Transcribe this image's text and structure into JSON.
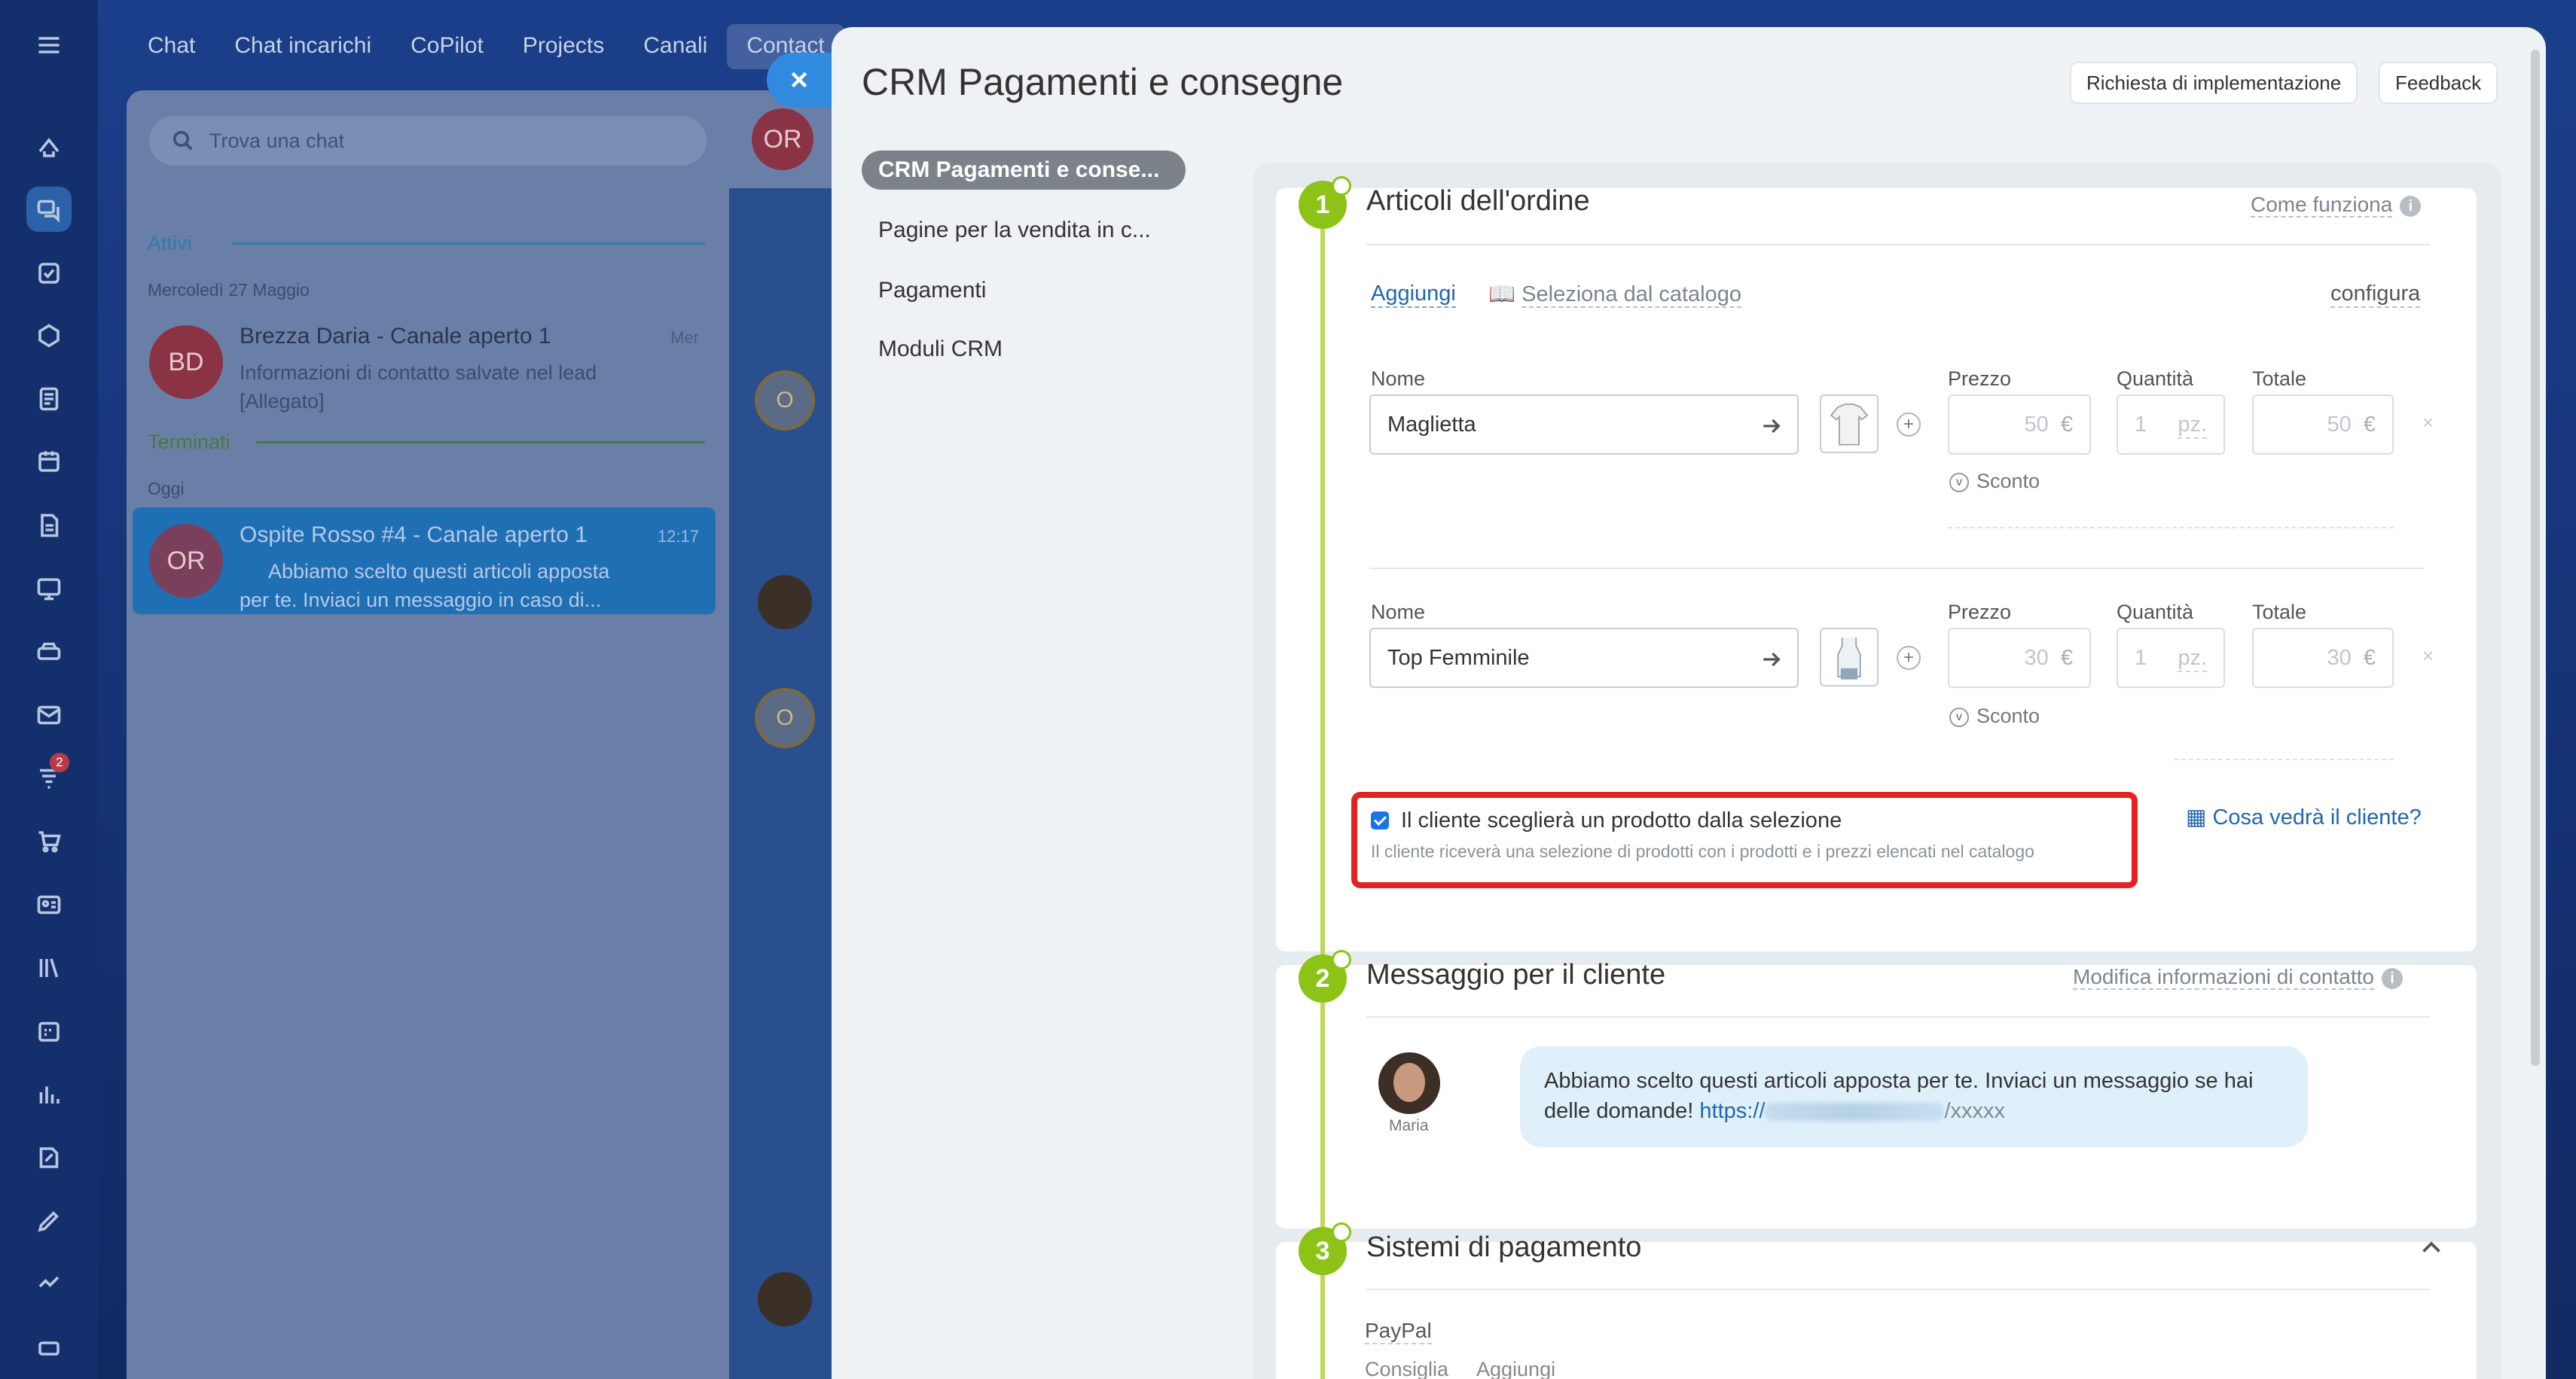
{
  "nav": {
    "tabs": [
      "Chat",
      "Chat incarichi",
      "CoPilot",
      "Projects",
      "Canali",
      "Contact"
    ],
    "selected_index": 5
  },
  "rail": {
    "badge_count": "2"
  },
  "chat": {
    "search_placeholder": "Trova una chat",
    "section_active": "Attivi",
    "date_1": "Mercoledì 27 Maggio",
    "item_1": {
      "avatar": "BD",
      "name": "Brezza Daria - Canale aperto 1",
      "time": "Mer",
      "message": "Informazioni di contatto salvate nel lead [Allegato]"
    },
    "section_closed": "Terminati",
    "date_2": "Oggi",
    "item_2": {
      "avatar": "OR",
      "name": "Ospite Rosso #4 - Canale aperto 1",
      "time": "12:17",
      "message": "Abbiamo scelto questi articoli apposta per te. Inviaci un messaggio in caso di..."
    },
    "conv_avatar": "OR",
    "conv_small_avatar": "O"
  },
  "slider": {
    "title": "CRM Pagamenti e consegne",
    "btn_impl": "Richiesta di implementazione",
    "btn_feedback": "Feedback",
    "menu": [
      "CRM Pagamenti e conse...",
      "Pagine per la vendita in c...",
      "Pagamenti",
      "Moduli CRM"
    ]
  },
  "order": {
    "step": "1",
    "title": "Articoli dell'ordine",
    "how_it_works": "Come funziona",
    "add": "Aggiungi",
    "select_catalog": "Seleziona dal catalogo",
    "configure": "configura",
    "label_name": "Nome",
    "label_price": "Prezzo",
    "label_qty": "Quantità",
    "label_total": "Totale",
    "discount": "Sconto",
    "products": [
      {
        "name": "Maglietta",
        "price": "50",
        "currency": "€",
        "qty": "1",
        "unit": "pz.",
        "total": "50"
      },
      {
        "name": "Top Femminile",
        "price": "30",
        "currency": "€",
        "qty": "1",
        "unit": "pz.",
        "total": "30"
      }
    ],
    "checkbox_label": "Il cliente sceglierà un prodotto dalla selezione",
    "checkbox_checked": true,
    "checkbox_hint": "Il cliente riceverà una selezione di prodotti con i prodotti e i prezzi elencati nel catalogo",
    "preview_link": "Cosa vedrà il cliente?"
  },
  "message": {
    "step": "2",
    "title": "Messaggio per il cliente",
    "edit_contact": "Modifica informazioni di contatto",
    "sender": "Maria",
    "text": "Abbiamo scelto questi articoli apposta per te. Inviaci un messaggio se hai delle domande!",
    "link_prefix": "https://",
    "link_suffix": "/xxxxx"
  },
  "payment": {
    "step": "3",
    "title": "Sistemi di pagamento",
    "system": "PayPal",
    "recommend": "Consiglia",
    "add": "Aggiungi"
  },
  "colors": {
    "accent": "#8cc316",
    "link": "#2067b0",
    "highlight": "#e52222",
    "brand_blue": "#2f8ae0"
  }
}
